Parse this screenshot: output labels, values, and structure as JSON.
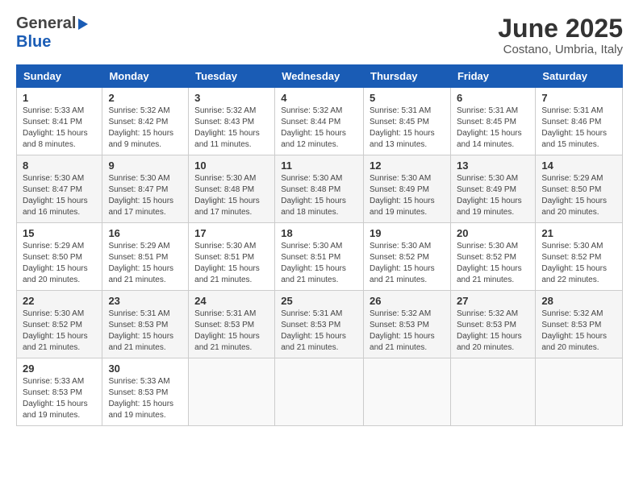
{
  "header": {
    "logo_general": "General",
    "logo_blue": "Blue",
    "title": "June 2025",
    "subtitle": "Costano, Umbria, Italy"
  },
  "columns": [
    "Sunday",
    "Monday",
    "Tuesday",
    "Wednesday",
    "Thursday",
    "Friday",
    "Saturday"
  ],
  "weeks": [
    [
      {
        "day": "1",
        "info": "Sunrise: 5:33 AM\nSunset: 8:41 PM\nDaylight: 15 hours\nand 8 minutes."
      },
      {
        "day": "2",
        "info": "Sunrise: 5:32 AM\nSunset: 8:42 PM\nDaylight: 15 hours\nand 9 minutes."
      },
      {
        "day": "3",
        "info": "Sunrise: 5:32 AM\nSunset: 8:43 PM\nDaylight: 15 hours\nand 11 minutes."
      },
      {
        "day": "4",
        "info": "Sunrise: 5:32 AM\nSunset: 8:44 PM\nDaylight: 15 hours\nand 12 minutes."
      },
      {
        "day": "5",
        "info": "Sunrise: 5:31 AM\nSunset: 8:45 PM\nDaylight: 15 hours\nand 13 minutes."
      },
      {
        "day": "6",
        "info": "Sunrise: 5:31 AM\nSunset: 8:45 PM\nDaylight: 15 hours\nand 14 minutes."
      },
      {
        "day": "7",
        "info": "Sunrise: 5:31 AM\nSunset: 8:46 PM\nDaylight: 15 hours\nand 15 minutes."
      }
    ],
    [
      {
        "day": "8",
        "info": "Sunrise: 5:30 AM\nSunset: 8:47 PM\nDaylight: 15 hours\nand 16 minutes."
      },
      {
        "day": "9",
        "info": "Sunrise: 5:30 AM\nSunset: 8:47 PM\nDaylight: 15 hours\nand 17 minutes."
      },
      {
        "day": "10",
        "info": "Sunrise: 5:30 AM\nSunset: 8:48 PM\nDaylight: 15 hours\nand 17 minutes."
      },
      {
        "day": "11",
        "info": "Sunrise: 5:30 AM\nSunset: 8:48 PM\nDaylight: 15 hours\nand 18 minutes."
      },
      {
        "day": "12",
        "info": "Sunrise: 5:30 AM\nSunset: 8:49 PM\nDaylight: 15 hours\nand 19 minutes."
      },
      {
        "day": "13",
        "info": "Sunrise: 5:30 AM\nSunset: 8:49 PM\nDaylight: 15 hours\nand 19 minutes."
      },
      {
        "day": "14",
        "info": "Sunrise: 5:29 AM\nSunset: 8:50 PM\nDaylight: 15 hours\nand 20 minutes."
      }
    ],
    [
      {
        "day": "15",
        "info": "Sunrise: 5:29 AM\nSunset: 8:50 PM\nDaylight: 15 hours\nand 20 minutes."
      },
      {
        "day": "16",
        "info": "Sunrise: 5:29 AM\nSunset: 8:51 PM\nDaylight: 15 hours\nand 21 minutes."
      },
      {
        "day": "17",
        "info": "Sunrise: 5:30 AM\nSunset: 8:51 PM\nDaylight: 15 hours\nand 21 minutes."
      },
      {
        "day": "18",
        "info": "Sunrise: 5:30 AM\nSunset: 8:51 PM\nDaylight: 15 hours\nand 21 minutes."
      },
      {
        "day": "19",
        "info": "Sunrise: 5:30 AM\nSunset: 8:52 PM\nDaylight: 15 hours\nand 21 minutes."
      },
      {
        "day": "20",
        "info": "Sunrise: 5:30 AM\nSunset: 8:52 PM\nDaylight: 15 hours\nand 21 minutes."
      },
      {
        "day": "21",
        "info": "Sunrise: 5:30 AM\nSunset: 8:52 PM\nDaylight: 15 hours\nand 22 minutes."
      }
    ],
    [
      {
        "day": "22",
        "info": "Sunrise: 5:30 AM\nSunset: 8:52 PM\nDaylight: 15 hours\nand 21 minutes."
      },
      {
        "day": "23",
        "info": "Sunrise: 5:31 AM\nSunset: 8:53 PM\nDaylight: 15 hours\nand 21 minutes."
      },
      {
        "day": "24",
        "info": "Sunrise: 5:31 AM\nSunset: 8:53 PM\nDaylight: 15 hours\nand 21 minutes."
      },
      {
        "day": "25",
        "info": "Sunrise: 5:31 AM\nSunset: 8:53 PM\nDaylight: 15 hours\nand 21 minutes."
      },
      {
        "day": "26",
        "info": "Sunrise: 5:32 AM\nSunset: 8:53 PM\nDaylight: 15 hours\nand 21 minutes."
      },
      {
        "day": "27",
        "info": "Sunrise: 5:32 AM\nSunset: 8:53 PM\nDaylight: 15 hours\nand 20 minutes."
      },
      {
        "day": "28",
        "info": "Sunrise: 5:32 AM\nSunset: 8:53 PM\nDaylight: 15 hours\nand 20 minutes."
      }
    ],
    [
      {
        "day": "29",
        "info": "Sunrise: 5:33 AM\nSunset: 8:53 PM\nDaylight: 15 hours\nand 19 minutes."
      },
      {
        "day": "30",
        "info": "Sunrise: 5:33 AM\nSunset: 8:53 PM\nDaylight: 15 hours\nand 19 minutes."
      },
      null,
      null,
      null,
      null,
      null
    ]
  ]
}
